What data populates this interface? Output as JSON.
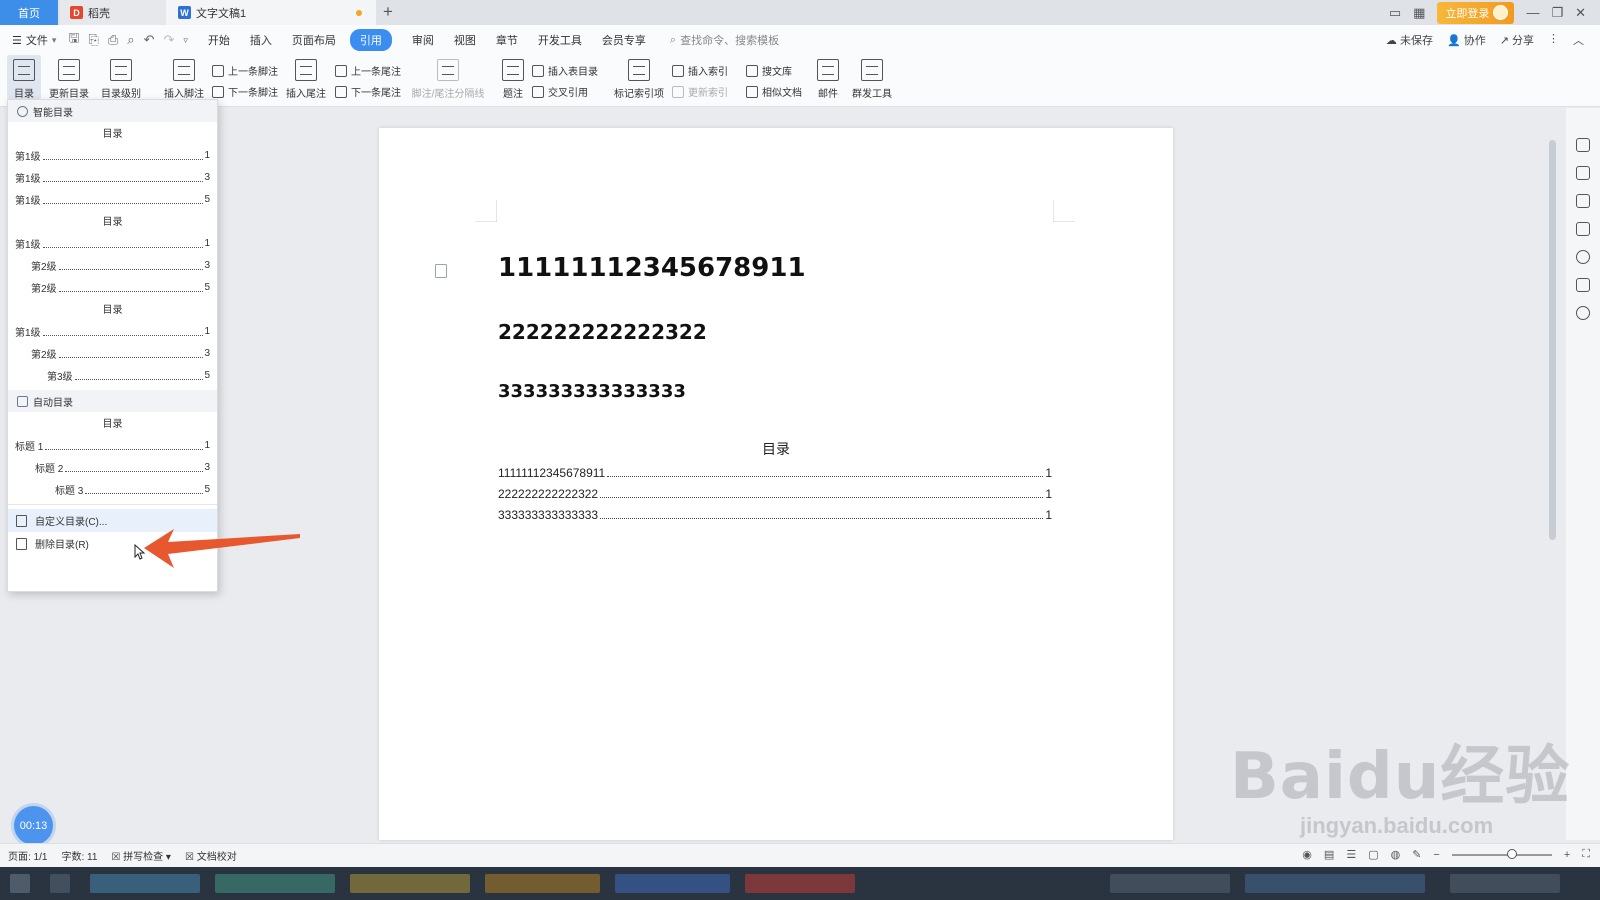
{
  "tabs": {
    "home": "首页",
    "docer": "稻壳",
    "doc": "文字文稿1"
  },
  "titlebar": {
    "login": "立即登录"
  },
  "menu": {
    "file": "文件",
    "items": [
      "开始",
      "插入",
      "页面布局",
      "引用",
      "审阅",
      "视图",
      "章节",
      "开发工具",
      "会员专享"
    ],
    "active": "引用",
    "search_placeholder": "查找命令、搜索模板",
    "right": [
      "未保存",
      "协作",
      "分享"
    ]
  },
  "ribbon": {
    "toc": "目录",
    "update_toc": "更新目录",
    "toc_level": "目录级别",
    "insert_footnote": "插入脚注",
    "prev_footnote": "上一条脚注",
    "next_footnote": "下一条脚注",
    "insert_endnote": "插入尾注",
    "prev_endnote": "上一条尾注",
    "next_endnote": "下一条尾注",
    "footnote_sep": "脚注/尾注分隔线",
    "caption": "题注",
    "insert_table_toc": "插入表目录",
    "cross_ref": "交叉引用",
    "mark_index": "标记索引项",
    "insert_index": "插入索引",
    "update_index": "更新索引",
    "search_lib": "搜文库",
    "similar_doc": "相似文档",
    "mail": "邮件",
    "mass_tool": "群发工具"
  },
  "dropdown": {
    "smart_section": "智能目录",
    "smart_blocks": [
      {
        "title": "目录",
        "lines": [
          {
            "label": "第1级",
            "page": "1",
            "indent": 0
          },
          {
            "label": "第1级",
            "page": "3",
            "indent": 0
          },
          {
            "label": "第1级",
            "page": "5",
            "indent": 0
          }
        ]
      },
      {
        "title": "目录",
        "lines": [
          {
            "label": "第1级",
            "page": "1",
            "indent": 0
          },
          {
            "label": "第2级",
            "page": "3",
            "indent": 1
          },
          {
            "label": "第2级",
            "page": "5",
            "indent": 1
          }
        ]
      },
      {
        "title": "目录",
        "lines": [
          {
            "label": "第1级",
            "page": "1",
            "indent": 0
          },
          {
            "label": "第2级",
            "page": "3",
            "indent": 1
          },
          {
            "label": "第3级",
            "page": "5",
            "indent": 2
          }
        ]
      }
    ],
    "auto_section": "自动目录",
    "auto_block": {
      "title": "目录",
      "lines": [
        {
          "label": "标题 1",
          "page": "1",
          "indent": 0
        },
        {
          "label": "标题 2",
          "page": "3",
          "indent": 1
        },
        {
          "label": "标题 3",
          "page": "5",
          "indent": 2
        }
      ]
    },
    "custom_toc": "自定义目录(C)...",
    "delete_toc": "删除目录(R)"
  },
  "document": {
    "heading1": "11111112345678911",
    "heading2": "222222222222322",
    "heading3": "333333333333333",
    "toc_title": "目录",
    "toc_entries": [
      {
        "text": "11111112345678911",
        "page": "1"
      },
      {
        "text": "222222222222322",
        "page": "1"
      },
      {
        "text": "333333333333333",
        "page": "1"
      }
    ]
  },
  "status": {
    "page": "页面: 1/1",
    "words": "字数: 11",
    "spell": "拼写检查",
    "proof": "文档校对"
  },
  "timer": "00:13",
  "watermark": {
    "main": "Baidu经验",
    "url": "jingyan.baidu.com"
  },
  "colors": {
    "accent": "#3b8ef0",
    "arrow": "#e8582f",
    "login": "#f29a20"
  }
}
